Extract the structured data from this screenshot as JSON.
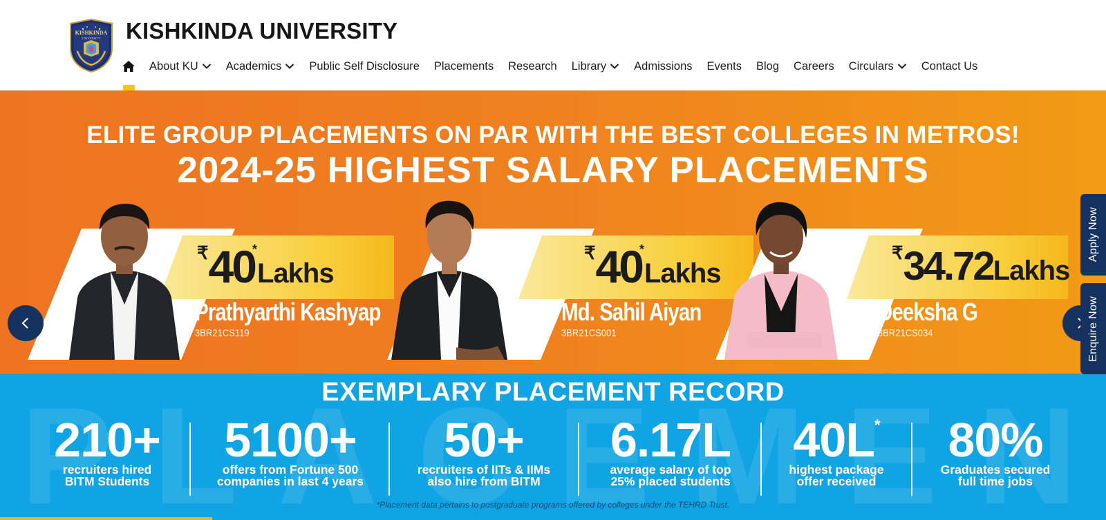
{
  "header": {
    "brand": "KISHKINDA UNIVERSITY",
    "logo_text": "KISHKINDA",
    "logo_subtext": "UNIVERSITY",
    "nav": [
      {
        "label": "About KU",
        "dropdown": true
      },
      {
        "label": "Academics",
        "dropdown": true
      },
      {
        "label": "Public Self Disclosure",
        "dropdown": false
      },
      {
        "label": "Placements",
        "dropdown": false
      },
      {
        "label": "Research",
        "dropdown": false
      },
      {
        "label": "Library",
        "dropdown": true
      },
      {
        "label": "Admissions",
        "dropdown": false
      },
      {
        "label": "Events",
        "dropdown": false
      },
      {
        "label": "Blog",
        "dropdown": false
      },
      {
        "label": "Careers",
        "dropdown": false
      },
      {
        "label": "Circulars",
        "dropdown": true
      },
      {
        "label": "Contact Us",
        "dropdown": false
      }
    ]
  },
  "hero": {
    "subtitle": "ELITE GROUP PLACEMENTS ON PAR WITH THE BEST COLLEGES IN METROS!",
    "title": "2024-25 HIGHEST SALARY PLACEMENTS",
    "cards": [
      {
        "currency": "₹",
        "amount": "40",
        "unit": "Lakhs",
        "star": "*",
        "name": "Prathyarthi Kashyap",
        "usn": "3BR21CS119"
      },
      {
        "currency": "₹",
        "amount": "40",
        "unit": "Lakhs",
        "star": "*",
        "name": "Md. Sahil Aiyan",
        "usn": "3BR21CS001"
      },
      {
        "currency": "₹",
        "amount": "34.72",
        "unit": "Lakhs",
        "star": "",
        "name": "Deeksha G",
        "usn": "3BR21CS034"
      }
    ]
  },
  "stats": {
    "title": "EXEMPLARY PLACEMENT RECORD",
    "watermark": "PLACEMENT",
    "items": [
      {
        "value": "210+",
        "line1": "recruiters hired",
        "line2": "BITM Students"
      },
      {
        "value": "5100+",
        "line1": "offers from Fortune 500",
        "line2": "companies in last 4 years"
      },
      {
        "value": "50+",
        "line1": "recruiters of IITs & IIMs",
        "line2": "also hire from BITM"
      },
      {
        "value": "6.17L",
        "line1": "average salary of top",
        "line2": "25% placed students"
      },
      {
        "value": "40L",
        "sup": "*",
        "line1": "highest package",
        "line2": "offer received"
      },
      {
        "value": "80%",
        "line1": "Graduates secured",
        "line2": "full time jobs"
      }
    ],
    "disclaimer": "*Placement data pertains to postgraduate programs offered by colleges under the TEHRD Trust."
  },
  "side_tabs": {
    "apply": "Apply Now",
    "enquire": "Enquire Now"
  },
  "colors": {
    "navy": "#15335e",
    "orange": "#ee7421",
    "blue": "#11a4e4",
    "yellow": "#f5c518"
  }
}
